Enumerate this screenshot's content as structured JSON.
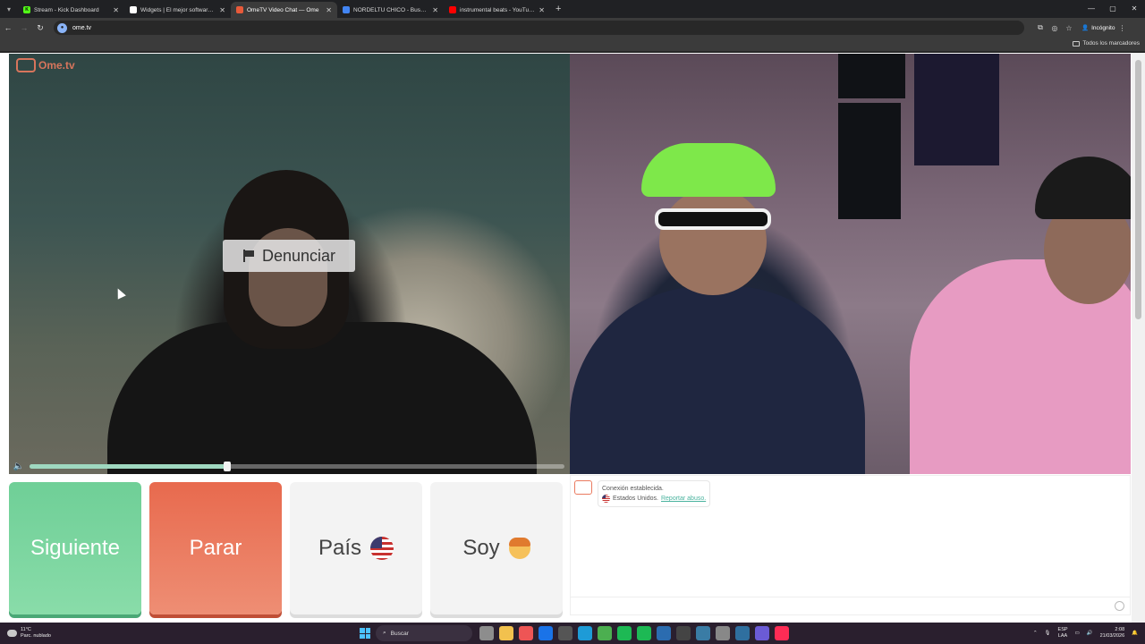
{
  "browser": {
    "tabs": [
      {
        "title": "Stream - Kick Dashboard",
        "favicon_color": "#53fc18",
        "favicon_letter": "K",
        "active": false
      },
      {
        "title": "Widgets | El mejor software par",
        "favicon_color": "#ffffff",
        "favicon_letter": "",
        "active": false
      },
      {
        "title": "OmeTV Video Chat — Ome",
        "favicon_color": "#e85a3a",
        "favicon_letter": "",
        "active": true
      },
      {
        "title": "NORDELTU CHICO - Buscar con",
        "favicon_color": "#4285f4",
        "favicon_letter": "",
        "active": false
      },
      {
        "title": "instrumental beats - YouTube",
        "favicon_color": "#ff0000",
        "favicon_letter": "",
        "active": false
      }
    ],
    "url": "ome.tv",
    "incognito_label": "Incógnito",
    "bookmarks_all": "Todos los marcadores"
  },
  "video": {
    "logo_text": "Ome.tv",
    "report_label": "Denunciar",
    "volume_level": 0.37
  },
  "controls": {
    "next_label": "Siguiente",
    "stop_label": "Parar",
    "country_label": "País",
    "gender_label": "Soy"
  },
  "chat": {
    "line1": "Conexión establecida.",
    "country": "Estados Unidos.",
    "report_link": "Reportar abuso."
  },
  "taskbar": {
    "temp": "11°C",
    "weather": "Parc. nublado",
    "search_placeholder": "Buscar",
    "lang1": "ESP",
    "lang2": "LAA",
    "time": "2:08",
    "date": "21/03/2026"
  },
  "colors": {
    "next": "#6fcf97",
    "stop": "#e86a4e",
    "accent": "#4ab39e"
  }
}
